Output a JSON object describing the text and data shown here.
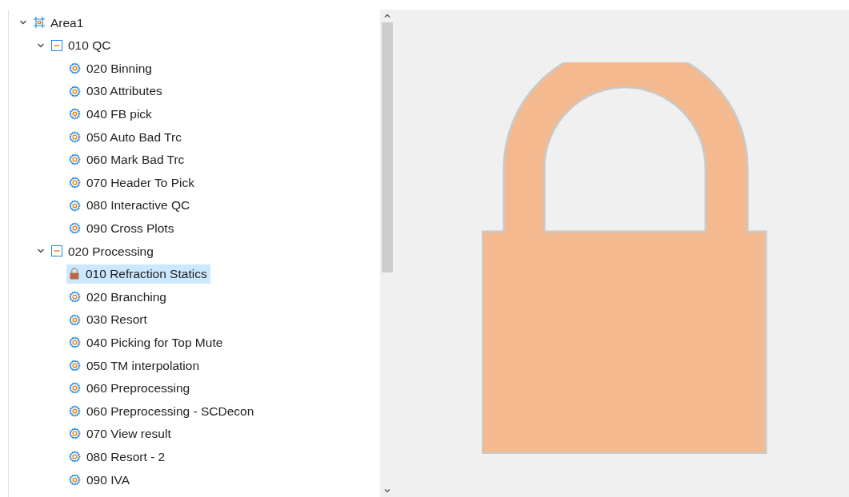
{
  "tree": [
    {
      "label": "Area1",
      "kind": "area",
      "expanded": true,
      "selected": false,
      "children": [
        {
          "label": "010 QC",
          "kind": "folder",
          "expanded": true,
          "selected": false,
          "children": [
            {
              "label": "020 Binning",
              "kind": "gear",
              "selected": false
            },
            {
              "label": "030 Attributes",
              "kind": "gear",
              "selected": false
            },
            {
              "label": "040 FB pick",
              "kind": "gear",
              "selected": false
            },
            {
              "label": "050 Auto Bad Trc",
              "kind": "gear",
              "selected": false
            },
            {
              "label": "060 Mark Bad Trc",
              "kind": "gear",
              "selected": false
            },
            {
              "label": "070 Header To Pick",
              "kind": "gear",
              "selected": false
            },
            {
              "label": "080 Interactive QC",
              "kind": "gear",
              "selected": false
            },
            {
              "label": "090 Cross Plots",
              "kind": "gear",
              "selected": false
            }
          ]
        },
        {
          "label": "020 Processing",
          "kind": "folder",
          "expanded": true,
          "selected": false,
          "children": [
            {
              "label": "010 Refraction Statics",
              "kind": "lock",
              "selected": true
            },
            {
              "label": "020 Branching",
              "kind": "gear",
              "selected": false
            },
            {
              "label": "030 Resort",
              "kind": "gear",
              "selected": false
            },
            {
              "label": "040 Picking for Top Mute",
              "kind": "gear",
              "selected": false
            },
            {
              "label": "050 TM interpolation",
              "kind": "gear",
              "selected": false
            },
            {
              "label": "060 Preprocessing",
              "kind": "gear",
              "selected": false
            },
            {
              "label": "060 Preprocessing - SCDecon",
              "kind": "gear",
              "selected": false
            },
            {
              "label": "070 View result",
              "kind": "gear",
              "selected": false
            },
            {
              "label": "080 Resort - 2",
              "kind": "gear",
              "selected": false
            },
            {
              "label": "090 IVA",
              "kind": "gear",
              "selected": false
            }
          ]
        }
      ]
    }
  ],
  "preview": {
    "kind": "lock"
  }
}
